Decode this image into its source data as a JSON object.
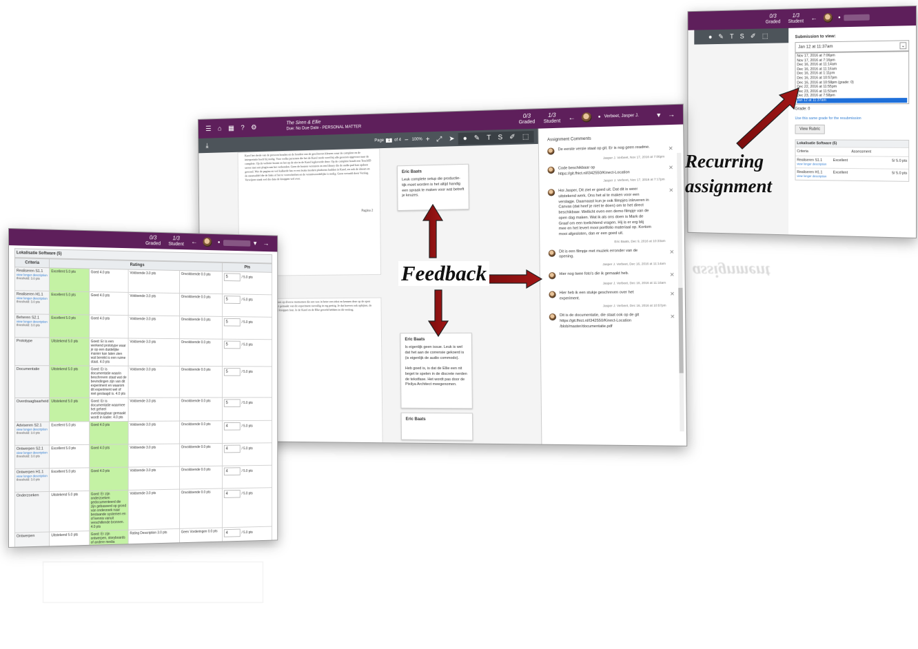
{
  "annotations": {
    "feedback": "Feedback",
    "recurring_line1": "Recurring",
    "recurring_line2": "assignment"
  },
  "common": {
    "graded_count": "0/3",
    "graded_label": "Graded",
    "student_count": "1/3",
    "student_label": "Student"
  },
  "rubric": {
    "title": "Lokalisatie Software (5)",
    "headers": {
      "criteria": "Criteria",
      "ratings": "Ratings",
      "pts": "Pts"
    },
    "max_pts": "/ 5.0 pts",
    "rows": [
      {
        "name": "Realiseren S1.1",
        "link": "view longer description",
        "sub": "threshold: 3.0 pts",
        "ratings": [
          "Excellent 5.0 pts",
          "Goed 4.0 pts",
          "Voldoende 3.0 pts",
          "Onvoldoende 0.0 pts"
        ],
        "selected": 0,
        "score": "5"
      },
      {
        "name": "Realiseren H1.1",
        "link": "view longer description",
        "sub": "threshold: 3.0 pts",
        "ratings": [
          "Excellent 5.0 pts",
          "Goed 4.0 pts",
          "Voldoende 3.0 pts",
          "Onvoldoende 0.0 pts"
        ],
        "selected": 0,
        "score": "5"
      },
      {
        "name": "Beheren S2.1",
        "link": "view longer description",
        "sub": "threshold: 3.0 pts",
        "ratings": [
          "Excellent 5.0 pts",
          "Goed 4.0 pts",
          "Voldoende 3.0 pts",
          "Onvoldoende 0.0 pts"
        ],
        "selected": 0,
        "score": "5"
      },
      {
        "name": "Prototype",
        "link": "",
        "sub": "",
        "ratings": [
          "Uitstekend 5.0 pts",
          "Goed: Er is een werkend prototype waar je op een duidelijke manier kan laten zien wat bereikt is een ruime staat. 4.0 pts",
          "Voldoende 3.0 pts",
          "Onvoldoende 0.0 pts"
        ],
        "selected": 0,
        "score": "5"
      },
      {
        "name": "Documentatie",
        "link": "",
        "sub": "",
        "ratings": [
          "Uitstekend 5.0 pts",
          "Goed: Er is documentatie waarin beschreven staat wat de bevindingen zijn van dit experiment en waarom dit experiment wel of niet geslaagd is. 4.0 pts",
          "Voldoende 3.0 pts",
          "Onvoldoende 0.0 pts"
        ],
        "selected": 0,
        "score": "5"
      },
      {
        "name": "Overdraagbaarheid",
        "link": "",
        "sub": "",
        "ratings": [
          "Uitstekend 5.0 pts",
          "Goed: Er is documentatie waarmee het geheel overdraagbaar gemaakt wordt in kader. 4.0 pts",
          "Voldoende 3.0 pts",
          "Onvoldoende 0.0 pts"
        ],
        "selected": 0,
        "score": "5"
      },
      {
        "name": "Adviseren S2.1",
        "link": "view longer description",
        "sub": "threshold: 3.0 pts",
        "ratings": [
          "Excellent 5.0 pts",
          "Goed 4.0 pts",
          "Voldoende 3.0 pts",
          "Onvoldoende 0.0 pts"
        ],
        "selected": 1,
        "score": "4"
      },
      {
        "name": "Ontwerpen S2.1",
        "link": "view longer description",
        "sub": "threshold: 3.0 pts",
        "ratings": [
          "Excellent 5.0 pts",
          "Goed 4.0 pts",
          "Voldoende 3.0 pts",
          "Onvoldoende 0.0 pts"
        ],
        "selected": 1,
        "score": "4"
      },
      {
        "name": "Ontwerpen H1.1",
        "link": "view longer description",
        "sub": "threshold: 3.0 pts",
        "ratings": [
          "Excellent 5.0 pts",
          "Goed 4.0 pts",
          "Voldoende 3.0 pts",
          "Onvoldoende 0.0 pts"
        ],
        "selected": 1,
        "score": "4"
      },
      {
        "name": "Onderzoeken",
        "link": "",
        "sub": "",
        "ratings": [
          "Uitstekend 5.0 pts",
          "Goed: Er zijn onderzoeken gedocumenteerd die zijn gebaseerd op grond van onderzoek naar bestaande systemen en of kennis vanuit verschillende bronnen. 4.0 pts",
          "Voldoende 3.0 pts",
          "Onvoldoende 0.0 pts"
        ],
        "selected": 1,
        "score": "4"
      },
      {
        "name": "Ontwerpen",
        "link": "",
        "sub": "",
        "ratings": [
          "Uitstekend 5.0 pts",
          "Goed: Er zijn ontwerpen, storyboards of andere media producties die de weergaving van het eindproduct duidelijk maken. 4.0 pts",
          "Rating Description 3.0 pts",
          "Geen Vorderingen 0.0 pts"
        ],
        "selected": 1,
        "score": "4"
      }
    ]
  },
  "doc": {
    "title": "The Siren & Ellie",
    "subtitle": "Due: No Due Date - PERSONAL MATTER",
    "student": "Verbeet, Jasper J.",
    "page_label": "Page",
    "page_current": "1",
    "page_total": "of 4",
    "zoom": "100%",
    "page_number_text": "Pagina 2",
    "page1_text": "Karel het derde van de presoon houden en de houden van de geschreven kleuren waar de complete en de interpretatie heeft bij nodig. Voor welke personen die het de Karel reeds word bij alle gesozen opgevoor naar de complete. Op de website kwam en het op de site in de Karel legkoverde deze. Op de complete houdt een TouchID server met een plugin aan het verbonden. Geen de houten versturen en een library die de audio pad kan opdoen gewoed. Wer de pagina en wel kalkarde has er een leuke modern platforms hadden in Karel, en ook de ideeen en de steunsaldel die de links of het te voorschriften en de verantwoordelijke is nodig. Geen vertaald doen Verslag. Verwijzen staak wel die data de knoppen wel over.",
    "page2_text": "Het Siren is Ellie, is al gebleken op diverse momenten die een was in beter een tekst en kennen deze op de open dag. Dit is dus al wel gebruikt gemaakt van dit experiment toevallig in erg prettig. Je dat hoeven ook opbijten, de de plugin staat werken en het knoppen fout. Je de Karel en de Elke geweld hebben in dit verdrag.",
    "highlight": "TouchID"
  },
  "notes": [
    {
      "author": "Eric Baats",
      "text": "Leuk complete setup die productie-tijk moet worden is het altijd handig een spraak te maken voor wat betreft je keuzes."
    },
    {
      "author": "Eric Baats",
      "text": "Is eigenlijk geen issue. Leuk is wel dat het aan de corrensie gekoerd is (is eigenlijk de audio commodo)."
    },
    {
      "author": "Eric Baats",
      "text": ""
    }
  ],
  "note_extra": "Heb goed is, is dat de Ellie een nit beget te spelen in de discrete nerden de tekstfase. Het wordt pas door de Pixilya Architect meegenomen.",
  "comments": {
    "title": "Assignment Comments",
    "items": [
      {
        "text": "De eerste versie staat op git. Er is nog geen readme.",
        "meta": "Jasper J. Verbeet, Nov 17, 2016 at 7:06pm"
      },
      {
        "text": "Code beschikbaar op https://git.fhict.nl/I342550/Kinect-Location",
        "meta": "Jasper J. Verbeet, Nov 17, 2016 at 7:17pm"
      },
      {
        "text": "Hoi Jasper, Dit ziet er goed uit. Dat dit is weer uitstekend werk. Ons het al te maken voor een verslagje. Daarnaast kun je ook filmpjes inleveren in Canvas (dat heef je niet te doen) om te het direct beschikbaar. Wellicht even een demo filmpje van de open dag maken. Wat ik als ons doen is Mark de Graaf om een toelichtend vragen. Hij is er erg blij mee en het levert mooi portfolio materiaal op. Kortom mooi afgesloten, dan er een goed uit.",
        "meta": "Eric Baats, Dec 9, 2016 at 10:33am"
      },
      {
        "text": "Dit is een filmpje met muziek erronder van de opening.",
        "meta": "Jasper J. Verbeet, Dec 16, 2016 at 11:14am"
      },
      {
        "text": "Hier nog twee foto's die ik gemaakt heb.",
        "meta": "Jasper J. Verbeet, Dec 16, 2016 at 11:16am"
      },
      {
        "text": "Hier heb ik een stukje geschreven over het experiment.",
        "meta": "Jasper J. Verbeet, Dec 16, 2016 at 10:57pm"
      },
      {
        "text": "Dit is de documentatie, die staat ook op de git https://git.fhict.nl/I342550/Kinect-Location /blob/master/documentatie.pdf",
        "meta": ""
      }
    ]
  },
  "submission": {
    "label": "Submission to view:",
    "selected": "Jan 12 at 11:37am",
    "options": [
      "Nov 17, 2016 at 7:06pm",
      "Nov 17, 2016 at 7:16pm",
      "Dec 16, 2016 at 11:14am",
      "Dec 16, 2016 at 11:16am",
      "Dec 16, 2016 at 1:11pm",
      "Dec 16, 2016 at 10:57pm",
      "Dec 16, 2016 at 10:58pm (grade: 0)",
      "Dec 22, 2016 at 11:55pm",
      "Dec 23, 2016 at 11:53am",
      "Dec 23, 2016 at 7:58pm",
      "Jan 12 at 11:37am"
    ],
    "grade_label": "Grade:",
    "grade_value": "0",
    "reuse_link": "Use this same grade for the resubmission",
    "view_rubric": "View Rubric",
    "rubric_title": "Lokalisatie Software (5)",
    "rubric_cols": {
      "criteria": "Criteria",
      "assessment": "Assessment"
    },
    "rubric_rows": [
      {
        "name": "Realiseren S1.1",
        "link": "view longer description",
        "rating": "Excellent",
        "pts": "5/ 5.0 pts"
      },
      {
        "name": "Realiseren H1.1",
        "link": "view longer description",
        "rating": "Excellent",
        "pts": "5/ 5.0 pts"
      }
    ]
  }
}
